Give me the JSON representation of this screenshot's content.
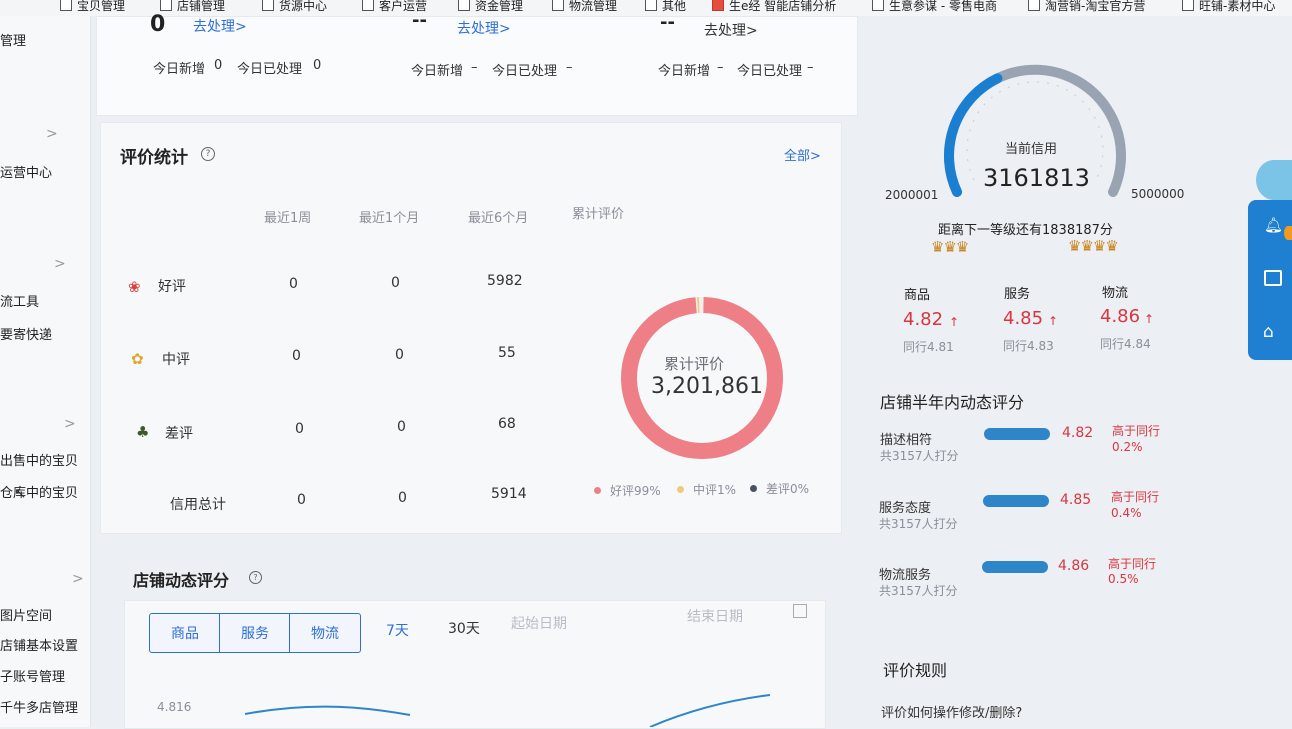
{
  "bookmarks": [
    "宝贝管理",
    "店铺管理",
    "货源中心",
    "客户运营",
    "资金管理",
    "物流管理",
    "其他",
    "生e经 智能店铺分析",
    "生意参谋 - 零售电商",
    "淘营销-淘宝官方营",
    "旺铺-素材中心"
  ],
  "sidebar": {
    "items": [
      "管理",
      "运营中心",
      "流工具",
      "要寄快递",
      "出售中的宝贝",
      "仓库中的宝贝",
      "图片空间",
      "店铺基本设置",
      "子账号管理",
      "千牛多店管理"
    ],
    "arrow": ">"
  },
  "todo": {
    "cols": [
      {
        "count": "0",
        "action": "去处理>",
        "new_label": "今日新增",
        "new_value": "0",
        "done_label": "今日已处理",
        "done_value": "0"
      },
      {
        "count": "--",
        "action": "去处理>",
        "new_label": "今日新增",
        "new_value": "–",
        "done_label": "今日已处理",
        "done_value": "–"
      },
      {
        "count": "--",
        "action": "去处理>",
        "new_label": "今日新增",
        "new_value": "–",
        "done_label": "今日已处理",
        "done_value": "–"
      }
    ]
  },
  "review_stats": {
    "title": "评价统计",
    "all_link": "全部>",
    "headers": [
      "最近1周",
      "最近1个月",
      "最近6个月",
      "累计评价"
    ],
    "rows": [
      {
        "label": "好评",
        "values": [
          "0",
          "0",
          "5982"
        ],
        "icon": "red-flower-icon"
      },
      {
        "label": "中评",
        "values": [
          "0",
          "0",
          "55"
        ],
        "icon": "yellow-flower-icon"
      },
      {
        "label": "差评",
        "values": [
          "0",
          "0",
          "68"
        ],
        "icon": "wilted-plant-icon"
      },
      {
        "label": "信用总计",
        "values": [
          "0",
          "0",
          "5914"
        ]
      }
    ],
    "donut": {
      "label": "累计评价",
      "total": "3,201,861",
      "good_pct": 99,
      "mid_pct": 1,
      "bad_pct": 0
    },
    "legend": [
      {
        "text": "好评99%",
        "color": "#ef7f86"
      },
      {
        "text": "中评1%",
        "color": "#f1c97a"
      },
      {
        "text": "差评0%",
        "color": "#4a5260"
      }
    ]
  },
  "shop_score": {
    "title": "店铺动态评分",
    "segments": [
      "商品",
      "服务",
      "物流"
    ],
    "ranges": [
      "7天",
      "30天"
    ],
    "start_placeholder": "起始日期",
    "end_placeholder": "结束日期",
    "y_tick": "4.816"
  },
  "credit": {
    "label": "当前信用",
    "value": "3161813",
    "min": "2000001",
    "max": "5000000",
    "progress": 0.387,
    "next_level": "距离下一等级还有1838187分",
    "dsr": [
      {
        "name": "商品",
        "score": "4.82",
        "peer": "同行4.81"
      },
      {
        "name": "服务",
        "score": "4.85",
        "peer": "同行4.83"
      },
      {
        "name": "物流",
        "score": "4.86",
        "peer": "同行4.84"
      }
    ],
    "arrow": "↑"
  },
  "half_year": {
    "title": "店铺半年内动态评分",
    "rows": [
      {
        "name": "描述相符",
        "count": "共3157人打分",
        "score": "4.82",
        "cmp": "高于同行",
        "pct": "0.2%",
        "fill": 0.964
      },
      {
        "name": "服务态度",
        "count": "共3157人打分",
        "score": "4.85",
        "cmp": "高于同行",
        "pct": "0.4%",
        "fill": 0.97
      },
      {
        "name": "物流服务",
        "count": "共3157人打分",
        "score": "4.86",
        "cmp": "高于同行",
        "pct": "0.5%",
        "fill": 0.972
      }
    ]
  },
  "rules": {
    "title": "评价规则",
    "item": "评价如何操作修改/删除?"
  }
}
